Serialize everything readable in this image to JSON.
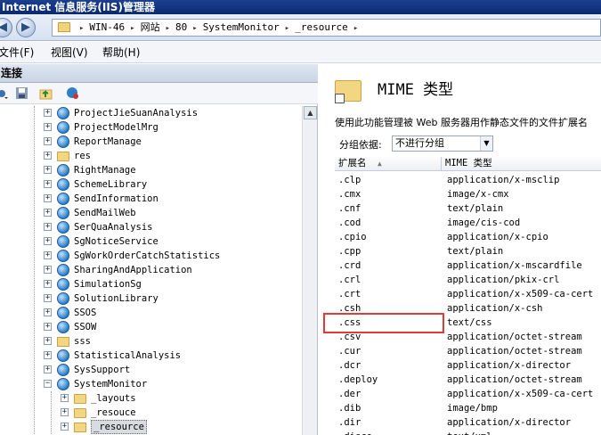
{
  "window": {
    "title": "Internet 信息服务(IIS)管理器"
  },
  "nav": {
    "back_label": "◀",
    "forward_label": "▶"
  },
  "address": {
    "crumbs": [
      "WIN-46",
      "网站",
      "80",
      "SystemMonitor",
      "_resource"
    ],
    "separator": "▸"
  },
  "menu": {
    "items": [
      "文件(F)",
      "视图(V)",
      "帮助(H)"
    ]
  },
  "connections": {
    "header": "连接",
    "tree": [
      {
        "label": "ProjectJieSuanAnalysis",
        "icon": "globe-icon",
        "expander": "+"
      },
      {
        "label": "ProjectModelMrg",
        "icon": "globe-icon",
        "expander": "+"
      },
      {
        "label": "ReportManage",
        "icon": "globe-icon",
        "expander": "+"
      },
      {
        "label": "res",
        "icon": "folder-icon",
        "expander": "+"
      },
      {
        "label": "RightManage",
        "icon": "globe-icon",
        "expander": "+"
      },
      {
        "label": "SchemeLibrary",
        "icon": "globe-icon",
        "expander": "+"
      },
      {
        "label": "SendInformation",
        "icon": "globe-icon",
        "expander": "+"
      },
      {
        "label": "SendMailWeb",
        "icon": "globe-icon",
        "expander": "+"
      },
      {
        "label": "SerQuaAnalysis",
        "icon": "globe-icon",
        "expander": "+"
      },
      {
        "label": "SgNoticeService",
        "icon": "globe-icon",
        "expander": "+"
      },
      {
        "label": "SgWorkOrderCatchStatistics",
        "icon": "globe-icon",
        "expander": "+"
      },
      {
        "label": "SharingAndApplication",
        "icon": "globe-icon",
        "expander": "+"
      },
      {
        "label": "SimulationSg",
        "icon": "globe-icon",
        "expander": "+"
      },
      {
        "label": "SolutionLibrary",
        "icon": "globe-icon",
        "expander": "+"
      },
      {
        "label": "SSOS",
        "icon": "globe-icon",
        "expander": "+"
      },
      {
        "label": "SSOW",
        "icon": "globe-icon",
        "expander": "+"
      },
      {
        "label": "sss",
        "icon": "folder-link-icon",
        "expander": "+"
      },
      {
        "label": "StatisticalAnalysis",
        "icon": "globe-icon",
        "expander": "+"
      },
      {
        "label": "SysSupport",
        "icon": "globe-icon",
        "expander": "+"
      },
      {
        "label": "SystemMonitor",
        "icon": "globe-icon",
        "expander": "−"
      },
      {
        "label": "_layouts",
        "icon": "folder-icon",
        "expander": "+"
      },
      {
        "label": "_resouce",
        "icon": "folder-icon",
        "expander": "+"
      },
      {
        "label": "_resource",
        "icon": "folder-link-icon",
        "expander": "+",
        "selected": true
      }
    ]
  },
  "feature": {
    "title": "MIME 类型",
    "description": "使用此功能管理被 Web 服务器用作静态文件的文件扩展名",
    "group_by_label": "分组依据:",
    "group_by_value": "不进行分组",
    "columns": [
      "扩展名",
      "MIME 类型"
    ],
    "rows": [
      [
        ".clp",
        "application/x-msclip"
      ],
      [
        ".cmx",
        "image/x-cmx"
      ],
      [
        ".cnf",
        "text/plain"
      ],
      [
        ".cod",
        "image/cis-cod"
      ],
      [
        ".cpio",
        "application/x-cpio"
      ],
      [
        ".cpp",
        "text/plain"
      ],
      [
        ".crd",
        "application/x-mscardfile"
      ],
      [
        ".crl",
        "application/pkix-crl"
      ],
      [
        ".crt",
        "application/x-x509-ca-cert"
      ],
      [
        ".csh",
        "application/x-csh"
      ],
      [
        ".css",
        "text/css"
      ],
      [
        ".csv",
        "application/octet-stream"
      ],
      [
        ".cur",
        "application/octet-stream"
      ],
      [
        ".dcr",
        "application/x-director"
      ],
      [
        ".deploy",
        "application/octet-stream"
      ],
      [
        ".der",
        "application/x-x509-ca-cert"
      ],
      [
        ".dib",
        "image/bmp"
      ],
      [
        ".dir",
        "application/x-director"
      ],
      [
        ".disco",
        "text/xml"
      ]
    ]
  },
  "colors": {
    "titlebar": "#0a2a6e",
    "highlight": "#e03a3a"
  }
}
